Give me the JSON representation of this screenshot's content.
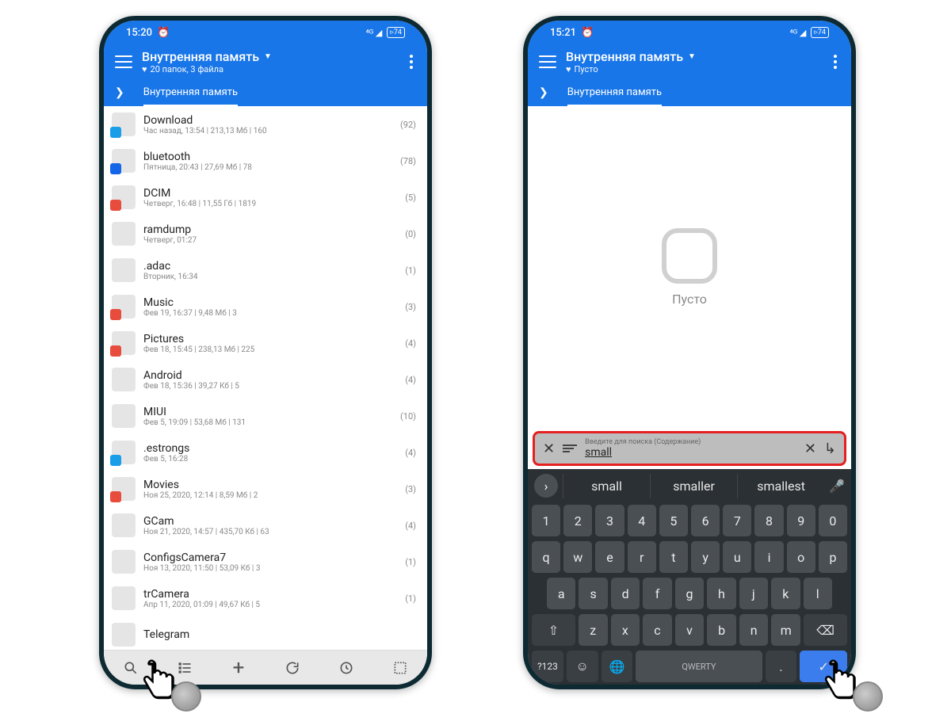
{
  "left": {
    "status": {
      "time": "15:20",
      "battery": "74"
    },
    "header": {
      "title": "Внутренняя память",
      "subtitle_prefix": "♥",
      "subtitle": "20 папок, 3 файла"
    },
    "tab": "Внутренняя память",
    "files": [
      {
        "name": "Download",
        "meta": "Час назад, 13:54 | 213,13 Мб | 160",
        "count": "(92)",
        "badge": "dl"
      },
      {
        "name": "bluetooth",
        "meta": "Пятница, 20:43 | 27,69 Мб | 78",
        "count": "(78)",
        "badge": "bt"
      },
      {
        "name": "DCIM",
        "meta": "Четверг, 16:48 | 11,55 Гб | 1819",
        "count": "(5)",
        "badge": "img"
      },
      {
        "name": "ramdump",
        "meta": "Четверг, 01:27",
        "count": "(0)",
        "badge": ""
      },
      {
        "name": ".adac",
        "meta": "Вторник, 16:34",
        "count": "(1)",
        "badge": ""
      },
      {
        "name": "Music",
        "meta": "Фев 19, 16:37 | 9,48 Мб | 3",
        "count": "(3)",
        "badge": "music"
      },
      {
        "name": "Pictures",
        "meta": "Фев 18, 15:45 | 238,13 Мб | 225",
        "count": "(4)",
        "badge": "img"
      },
      {
        "name": "Android",
        "meta": "Фев 18, 15:36 | 39,27 Кб | 5",
        "count": "(4)",
        "badge": ""
      },
      {
        "name": "MIUI",
        "meta": "Фев 5, 19:09 | 53,68 Мб | 131",
        "count": "(10)",
        "badge": ""
      },
      {
        "name": ".estrongs",
        "meta": "Фев 5, 16:28",
        "count": "(4)",
        "badge": "es"
      },
      {
        "name": "Movies",
        "meta": "Ноя 25, 2020, 12:14 | 8,59 Мб | 2",
        "count": "(3)",
        "badge": "vid"
      },
      {
        "name": "GCam",
        "meta": "Ноя 21, 2020, 14:57 | 435,70 Кб | 63",
        "count": "(4)",
        "badge": ""
      },
      {
        "name": "ConfigsCamera7",
        "meta": "Ноя 13, 2020, 11:50 | 53,09 Кб | 3",
        "count": "(1)",
        "badge": ""
      },
      {
        "name": "trCamera",
        "meta": "Апр 11, 2020, 01:09 | 49,67 Кб | 5",
        "count": "(1)",
        "badge": ""
      },
      {
        "name": "Telegram",
        "meta": "",
        "count": "",
        "badge": ""
      }
    ]
  },
  "right": {
    "status": {
      "time": "15:21",
      "battery": "74"
    },
    "header": {
      "title": "Внутренняя память",
      "subtitle_prefix": "♥",
      "subtitle": "Пусто"
    },
    "tab": "Внутренняя память",
    "empty_label": "Пусто",
    "search": {
      "hint": "Введите для поиска (Содержание)",
      "value": "small"
    },
    "suggestions": [
      "small",
      "smaller",
      "smallest"
    ],
    "kb_layout_label": "QWERTY",
    "num_row": [
      "1",
      "2",
      "3",
      "4",
      "5",
      "6",
      "7",
      "8",
      "9",
      "0"
    ],
    "row1": [
      "q",
      "w",
      "e",
      "r",
      "t",
      "y",
      "u",
      "i",
      "o",
      "p"
    ],
    "row2": [
      "a",
      "s",
      "d",
      "f",
      "g",
      "h",
      "j",
      "k",
      "l"
    ],
    "row3": [
      "z",
      "x",
      "c",
      "v",
      "b",
      "n",
      "m"
    ],
    "sym_key": "?123"
  }
}
